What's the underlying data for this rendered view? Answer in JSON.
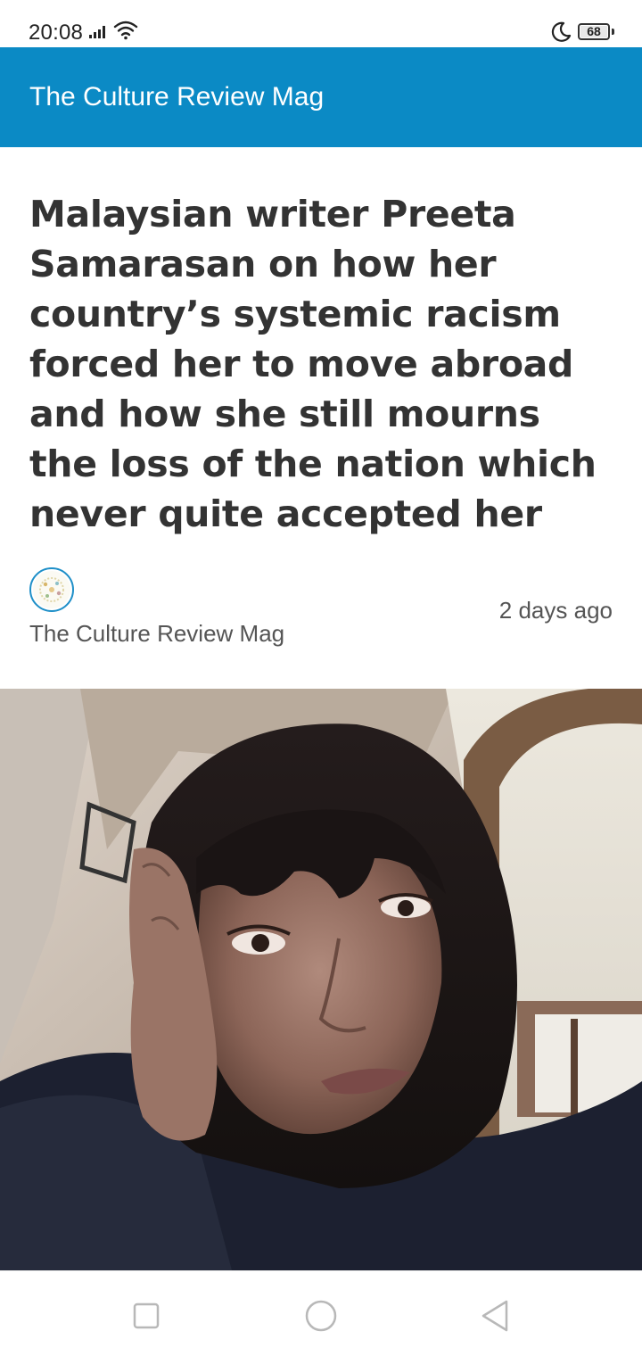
{
  "status_bar": {
    "time": "20:08",
    "battery": "68",
    "icons": [
      "signal-icon",
      "wifi-icon",
      "moon-icon",
      "battery-icon"
    ]
  },
  "app_bar": {
    "title": "The Culture Review Mag",
    "color": "#0b8ac5"
  },
  "article": {
    "headline": "Malaysian writer Preeta Samarasan on how her country’s systemic racism forced her to move abroad and how she still mourns the loss of the nation which never quite accepted her",
    "author": "The Culture Review Mag",
    "published": "2 days ago"
  },
  "nav_bar": {
    "icons": [
      "recent-apps-icon",
      "home-icon",
      "back-icon"
    ]
  }
}
